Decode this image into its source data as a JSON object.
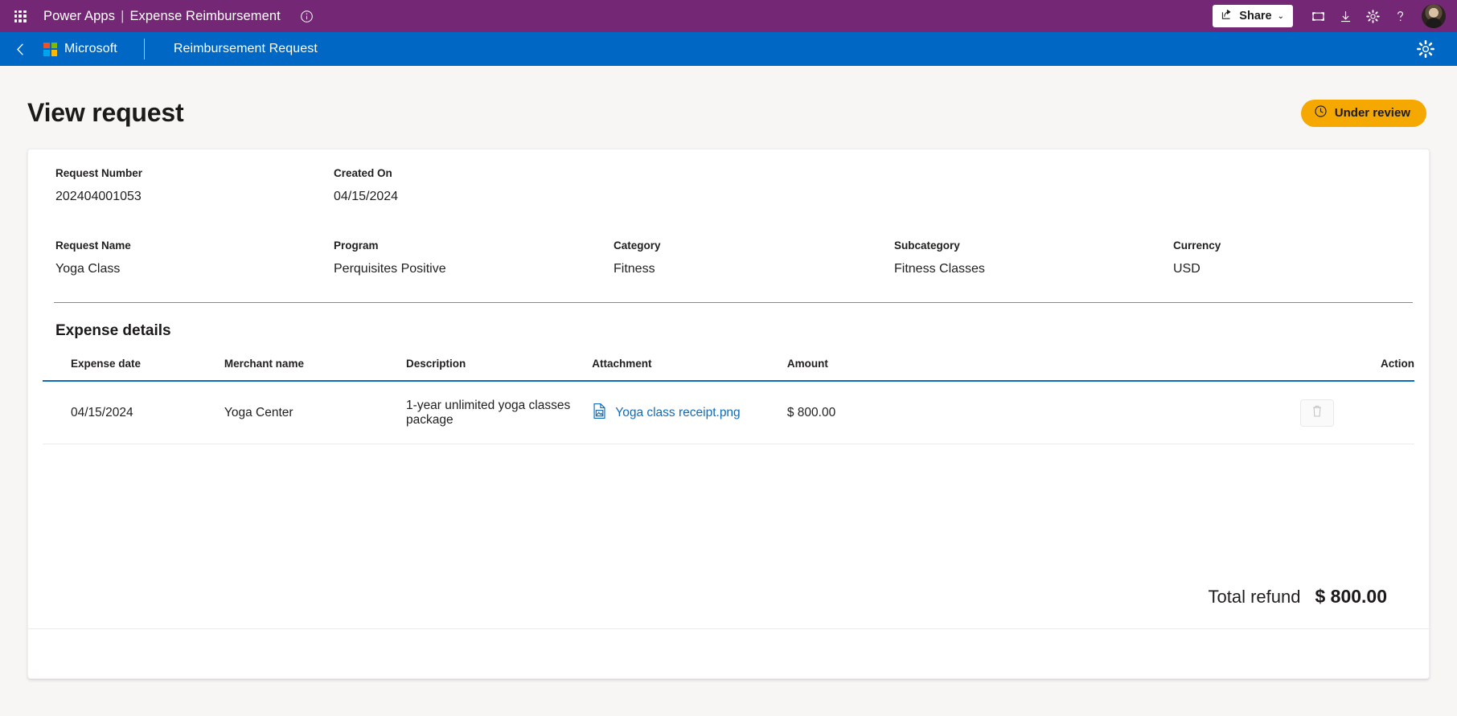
{
  "appbar": {
    "waffle_icon": "app-launcher-icon",
    "product": "Power Apps",
    "separator": "|",
    "app_name": "Expense Reimbursement",
    "info_icon": "info-circle-icon",
    "share_label": "Share",
    "share_icon": "share-icon",
    "share_chevron": "chevron-down-icon",
    "fullscreen_icon": "fullscreen-icon",
    "download_icon": "download-icon",
    "settings_icon": "gear-icon",
    "help_icon": "help-question-icon",
    "avatar_icon": "user-avatar"
  },
  "bluebar": {
    "back_icon": "chevron-left-icon",
    "logo_name": "Microsoft",
    "title": "Reimbursement Request",
    "settings_icon": "gear-icon"
  },
  "page": {
    "title": "View request",
    "status": {
      "label": "Under review",
      "icon": "clock-icon",
      "color": "#f5a800"
    }
  },
  "details": {
    "row1": [
      {
        "label": "Request Number",
        "value": "202404001053"
      },
      {
        "label": "Created On",
        "value": "04/15/2024"
      }
    ],
    "row2": [
      {
        "label": "Request Name",
        "value": "Yoga Class"
      },
      {
        "label": "Program",
        "value": "Perquisites Positive"
      },
      {
        "label": "Category",
        "value": "Fitness"
      },
      {
        "label": "Subcategory",
        "value": "Fitness Classes"
      },
      {
        "label": "Currency",
        "value": "USD"
      }
    ]
  },
  "expense": {
    "section_title": "Expense details",
    "columns": [
      "Expense date",
      "Merchant name",
      "Description",
      "Attachment",
      "Amount",
      "Action"
    ],
    "rows": [
      {
        "date": "04/15/2024",
        "merchant": "Yoga Center",
        "description": "1-year unlimited yoga classes package",
        "attachment": "Yoga class receipt.png",
        "attachment_icon": "image-file-icon",
        "amount": "$ 800.00",
        "action_icon": "trash-icon"
      }
    ],
    "total_label": "Total refund",
    "total_value": "$ 800.00"
  }
}
